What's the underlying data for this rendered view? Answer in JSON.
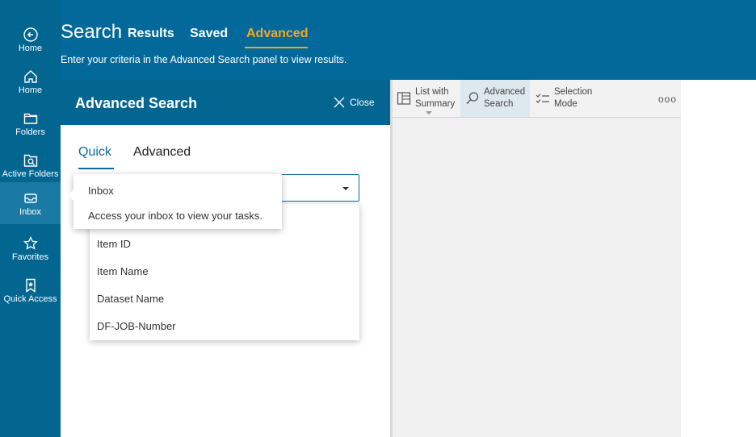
{
  "rail": {
    "items": [
      {
        "label": "Home",
        "icon": "back-arrow-icon"
      },
      {
        "label": "Home",
        "icon": "home-icon"
      },
      {
        "label": "Folders",
        "icon": "folder-icon"
      },
      {
        "label": "Active Folders",
        "icon": "active-folder-icon"
      },
      {
        "label": "Inbox",
        "icon": "inbox-icon"
      },
      {
        "label": "Favorites",
        "icon": "star-icon"
      },
      {
        "label": "Quick Access",
        "icon": "bookmark-icon"
      }
    ]
  },
  "header": {
    "title": "Search",
    "tabs": [
      {
        "label": "Results"
      },
      {
        "label": "Saved"
      },
      {
        "label": "Advanced",
        "active": true
      }
    ],
    "subtitle": "Enter your criteria in the Advanced Search panel to view results."
  },
  "panel": {
    "title": "Advanced Search",
    "close_label": "Close",
    "tabs": {
      "quick": "Quick",
      "advanced": "Advanced"
    },
    "dropdown_options": [
      "Item ID",
      "Item Name",
      "Dataset Name",
      "DF-JOB-Number"
    ]
  },
  "tooltip": {
    "title": "Inbox",
    "text": "Access your inbox to view your tasks."
  },
  "toolbar": {
    "list_summary": [
      "List with",
      "Summary"
    ],
    "advanced_search": [
      "Advanced",
      "Search"
    ],
    "selection_mode": [
      "Selection",
      "Mode"
    ],
    "more": "ooo"
  },
  "colors": {
    "rail_bg": "#036691",
    "header_bg": "#03699a",
    "accent": "#f5a623",
    "link_blue": "#0f6a9e"
  }
}
